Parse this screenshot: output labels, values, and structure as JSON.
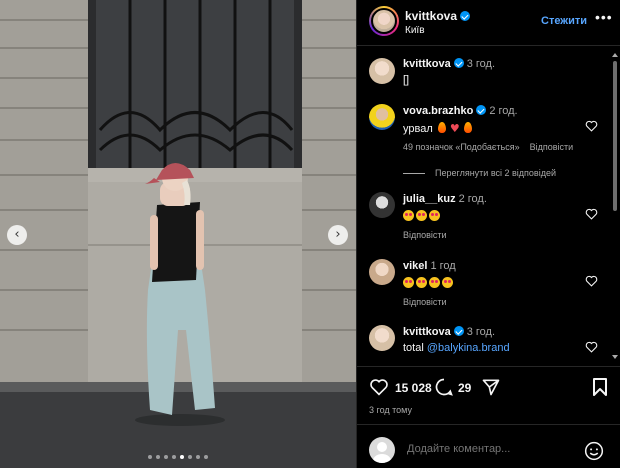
{
  "header": {
    "username": "kvittkova",
    "location": "Київ",
    "follow_label": "Стежити",
    "more_glyph": "•••"
  },
  "comments": [
    {
      "username": "kvittkova",
      "time": "3 год.",
      "text": "[]",
      "verified": true
    },
    {
      "username": "vova.brazhko",
      "time": "2 год.",
      "text": "урвал",
      "emoji": [
        "fire",
        "red-heart",
        "fire"
      ],
      "likes": "49 позначок «Подобається»",
      "reply": "Відповісти",
      "verified": true
    },
    {
      "username": "julia__kuz",
      "time": "2 год.",
      "emoji": [
        "heart-eyes",
        "heart-eyes",
        "heart-eyes"
      ],
      "reply": "Відповісти"
    },
    {
      "username": "vikel",
      "time": "1 год",
      "emoji": [
        "heart-eyes",
        "heart-eyes",
        "heart-eyes",
        "heart-eyes"
      ],
      "reply": "Відповісти"
    },
    {
      "username": "kvittkova",
      "time": "3 год.",
      "text": "total",
      "mention": "@balykina.brand",
      "verified": true
    }
  ],
  "view_replies": "Переглянути всі 2 відповідей",
  "actions": {
    "likes": "15 028",
    "comments": "29",
    "posted": "3 год тому"
  },
  "composer": {
    "placeholder": "Додайте коментар..."
  },
  "carousel": {
    "dots": 8,
    "active_index": 4
  },
  "colors": {
    "link": "#58a6ff",
    "verified": "#0095f6",
    "cap": "#b5525a"
  }
}
